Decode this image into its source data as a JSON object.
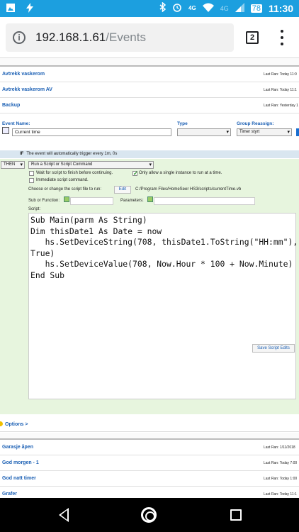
{
  "status_bar": {
    "left_icons": [
      "image-icon",
      "bolt-icon"
    ],
    "right_icons": [
      "bluetooth-icon",
      "alarm-icon",
      "wifi-icon",
      "signal-icon",
      "battery-icon"
    ],
    "net_label": "4G",
    "net_label_2": "4G",
    "sim_label": "78",
    "time": "11:30"
  },
  "browser": {
    "url_host": "192.168.1.61",
    "url_path": "/Events",
    "tab_count": "2"
  },
  "events_top": [
    {
      "name": "Avtrekk vaskerom",
      "last_ran": "Last Ran: Today 11:0"
    },
    {
      "name": "Avtrekk vaskerom AV",
      "last_ran": "Last Ran: Today 11:1"
    },
    {
      "name": "Backup",
      "last_ran": "Last Ran: Yesterday 1"
    }
  ],
  "editor": {
    "event_name_label": "Event Name:",
    "event_name_value": "Current time",
    "type_label": "Type",
    "type_value": "",
    "group_label": "Group Reassign:",
    "group_value": "Timer styrt",
    "if_label": "IF",
    "if_text": "The event will automatically trigger every 1m, 0s",
    "then_value": "THEN",
    "action_value": "Run a Script or Script Command",
    "wait_label": "Wait for script to finish before continuing.",
    "wait_checked": false,
    "single_label": "Only allow a single instance to run at a time.",
    "single_checked": true,
    "immediate_label": "Immediate script command.",
    "immediate_checked": false,
    "choose_label": "Choose or change the script file to run:",
    "edit_button": "Edit",
    "script_path": "C:/Program Files/HomeSeer HS3/scripts/currentTime.vb",
    "sub_label": "Sub or Function:",
    "params_label": "Parameters:",
    "script_label": "Script:",
    "script_text": "Sub Main(parm As String)\nDim thisDate1 As Date = now\n   hs.SetDeviceString(708, thisDate1.ToString(\"HH:mm\"),\nTrue)\n   hs.SetDeviceValue(708, Now.Hour * 100 + Now.Minute)\nEnd Sub",
    "save_button": "Save Script Edits",
    "options_label": "Options >"
  },
  "events_bottom": [
    {
      "name": "Garasje åpen",
      "last_ran": "Last Ran: 1/11/2018"
    },
    {
      "name": "God morgen - 1",
      "last_ran": "Last Ran: Today 7:00"
    },
    {
      "name": "God natt timer",
      "last_ran": "Last Ran: Today 1:00"
    },
    {
      "name": "Grafer",
      "last_ran": "Last Ran: Today 11:1"
    }
  ],
  "nav": {
    "icons": [
      "back-icon",
      "home-icon",
      "recents-icon"
    ]
  }
}
